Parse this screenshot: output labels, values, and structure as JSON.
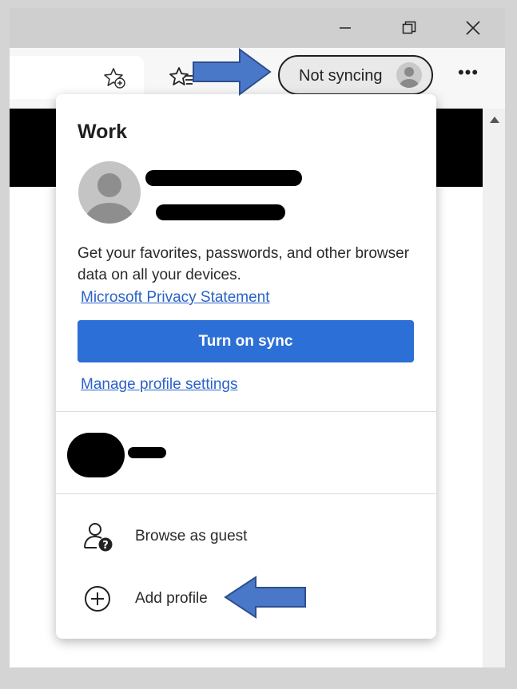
{
  "toolbar": {
    "sync_status": "Not syncing",
    "more_label": "•••"
  },
  "profile_flyout": {
    "title": "Work",
    "description": "Get your favorites, passwords, and other browser data on all your devices.",
    "privacy_link": "Microsoft Privacy Statement",
    "sync_button": "Turn on sync",
    "manage_link": "Manage profile settings",
    "browse_guest": "Browse as guest",
    "add_profile": "Add profile"
  },
  "icons": {
    "favorites_add": "favorites-add-icon",
    "favorites_bar": "favorites-icon",
    "avatar": "person-icon",
    "guest": "guest-icon",
    "add": "plus-circle-icon"
  },
  "colors": {
    "accent": "#2c6fd6",
    "link": "#2a62c9",
    "annotation_arrow": "#4a78c8"
  }
}
